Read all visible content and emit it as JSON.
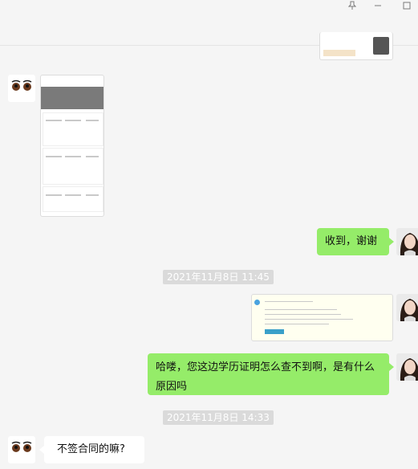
{
  "window": {
    "pin_icon": "pin-icon",
    "minimize_icon": "minimize-icon",
    "maximize_icon": "maximize-icon"
  },
  "messages": {
    "received_text": "收到，谢谢",
    "question_text": "哈喽，您这边学历证明怎么查不到啊，是有什么原因吗",
    "reply_text": "不签合同的嘛?"
  },
  "timestamps": {
    "first": "2021年11月8日 11:45",
    "second": "2021年11月8日 14:33"
  },
  "colors": {
    "bubble_green": "#95ec69",
    "bubble_white": "#ffffff",
    "background": "#f5f5f5",
    "timestamp_bg": "#dadada"
  }
}
